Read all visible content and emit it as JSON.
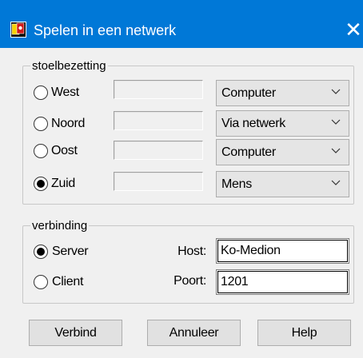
{
  "window": {
    "title": "Spelen in een netwerk",
    "close_glyph": "✕"
  },
  "seats": {
    "legend": "stoelbezetting",
    "rows": [
      {
        "label": "West",
        "selected": false,
        "player": "Computer"
      },
      {
        "label": "Noord",
        "selected": false,
        "player": "Via netwerk"
      },
      {
        "label": "Oost",
        "selected": false,
        "player": "Computer"
      },
      {
        "label": "Zuid",
        "selected": true,
        "player": "Mens"
      }
    ]
  },
  "connection": {
    "legend": "verbinding",
    "server_label": "Server",
    "client_label": "Client",
    "mode": "Server",
    "host_label": "Host:",
    "host_value": "Ko-Medion",
    "port_label": "Poort:",
    "port_value": "1201"
  },
  "buttons": {
    "connect": "Verbind",
    "cancel": "Annuleer",
    "help": "Help"
  },
  "icons": {
    "app": "cards-app-icon",
    "close": "close-icon",
    "dropdown": "chevron-down-icon"
  },
  "colors": {
    "titlebar": "#0078d7",
    "window_bg": "#f0f0f0"
  }
}
